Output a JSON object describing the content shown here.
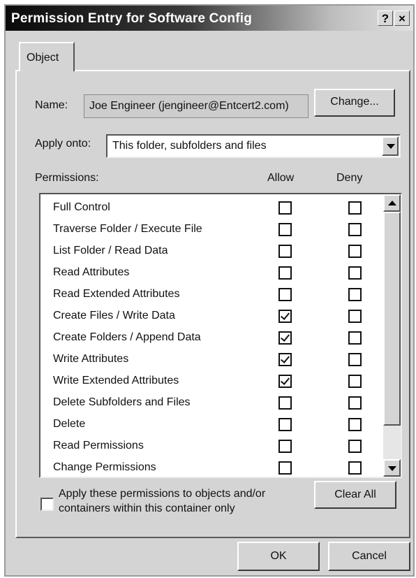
{
  "window": {
    "title": "Permission Entry for Software Config",
    "help_label": "?",
    "close_label": "×"
  },
  "tabs": [
    {
      "label": "Object",
      "selected": true
    }
  ],
  "name": {
    "label": "Name:",
    "value": "Joe Engineer (jengineer@Entcert2.com)",
    "change_label": "Change..."
  },
  "apply_onto": {
    "label": "Apply onto:",
    "value": "This folder, subfolders and files"
  },
  "permissions": {
    "header": "Permissions:",
    "allow_header": "Allow",
    "deny_header": "Deny",
    "rows": [
      {
        "label": "Full Control",
        "allow": false,
        "deny": false
      },
      {
        "label": "Traverse Folder / Execute File",
        "allow": false,
        "deny": false
      },
      {
        "label": "List Folder / Read Data",
        "allow": false,
        "deny": false
      },
      {
        "label": "Read Attributes",
        "allow": false,
        "deny": false
      },
      {
        "label": "Read Extended Attributes",
        "allow": false,
        "deny": false
      },
      {
        "label": "Create Files / Write Data",
        "allow": true,
        "deny": false
      },
      {
        "label": "Create Folders / Append Data",
        "allow": true,
        "deny": false
      },
      {
        "label": "Write Attributes",
        "allow": true,
        "deny": false
      },
      {
        "label": "Write Extended Attributes",
        "allow": true,
        "deny": false
      },
      {
        "label": "Delete Subfolders and Files",
        "allow": false,
        "deny": false
      },
      {
        "label": "Delete",
        "allow": false,
        "deny": false
      },
      {
        "label": "Read Permissions",
        "allow": false,
        "deny": false
      },
      {
        "label": "Change Permissions",
        "allow": false,
        "deny": false
      }
    ]
  },
  "apply_container": {
    "label_line1": "Apply these permissions to objects and/or",
    "label_line2": "containers within this container only",
    "checked": false
  },
  "buttons": {
    "clear_all": "Clear All",
    "ok": "OK",
    "cancel": "Cancel"
  }
}
